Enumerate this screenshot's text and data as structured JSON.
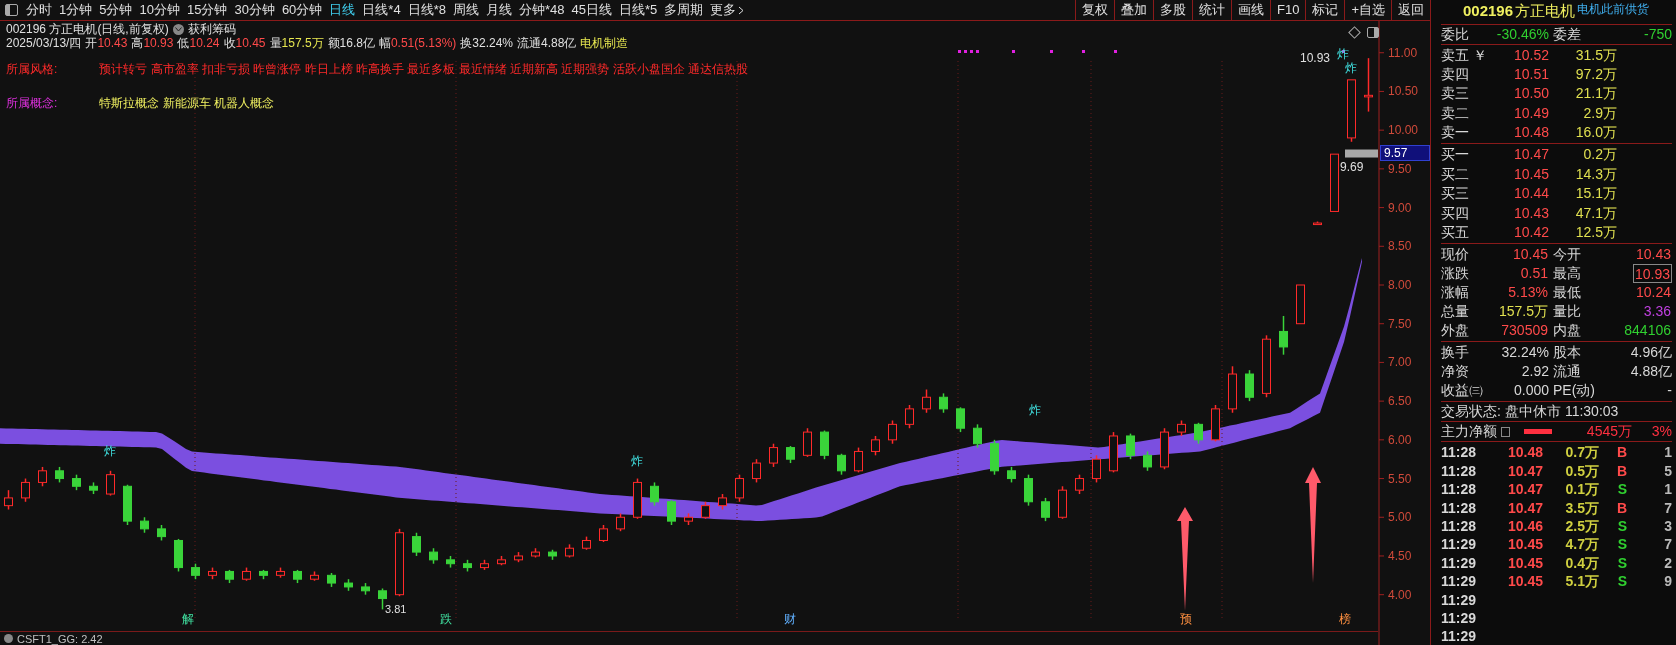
{
  "toolbar": {
    "periods": [
      {
        "label": "分时",
        "selected": false
      },
      {
        "label": "1分钟",
        "selected": false
      },
      {
        "label": "5分钟",
        "selected": false
      },
      {
        "label": "10分钟",
        "selected": false
      },
      {
        "label": "15分钟",
        "selected": false
      },
      {
        "label": "30分钟",
        "selected": false
      },
      {
        "label": "60分钟",
        "selected": false
      },
      {
        "label": "日线",
        "selected": true
      },
      {
        "label": "日线*4",
        "selected": false
      },
      {
        "label": "日线*8",
        "selected": false
      },
      {
        "label": "周线",
        "selected": false
      },
      {
        "label": "月线",
        "selected": false
      },
      {
        "label": "分钟*48",
        "selected": false
      },
      {
        "label": "45日线",
        "selected": false
      },
      {
        "label": "日线*5",
        "selected": false
      },
      {
        "label": "多周期",
        "selected": false
      },
      {
        "label": "更多",
        "selected": false
      }
    ],
    "actions": [
      "复权",
      "叠加",
      "多股",
      "统计",
      "画线",
      "F10",
      "标记",
      "+自选",
      "返回"
    ]
  },
  "header": {
    "title": "002196 方正电机(日线,前复权)",
    "indicator": "获利筹码",
    "date": "2025/03/13/四",
    "quote": [
      {
        "label": "开",
        "value": "10.43",
        "color": "#ff4a4a"
      },
      {
        "label": "高",
        "value": "10.93",
        "color": "#ff4a4a"
      },
      {
        "label": "低",
        "value": "10.24",
        "color": "#ff4a4a"
      },
      {
        "label": "收",
        "value": "10.45",
        "color": "#ff4a4a"
      },
      {
        "label": "量",
        "value": "157.5万",
        "color": "#e8e850"
      },
      {
        "label": "额",
        "value": "16.8亿",
        "color": "#e0e0e0"
      },
      {
        "label": "幅",
        "value": "0.51(5.13%)",
        "color": "#ff4a4a"
      },
      {
        "label": "换",
        "value": "32.24%",
        "color": "#e0e0e0"
      },
      {
        "label": "流通",
        "value": "4.88亿",
        "color": "#e0e0e0"
      }
    ],
    "industry": "电机制造"
  },
  "style_row": {
    "label": "所属风格:",
    "tags": "预计转亏 高市盈率 扣非亏损 昨曾涨停 昨日上榜 昨高换手 最近多板 最近情绪 近期新高 近期强势 活跃小盘国企 通达信热股"
  },
  "concept_row": {
    "label": "所属概念:",
    "tags": "特斯拉概念 新能源车 机器人概念"
  },
  "chart": {
    "chart_data": {
      "type": "candlestick",
      "ohlc": [
        [
          5.15,
          5.35,
          5.1,
          5.25
        ],
        [
          5.25,
          5.5,
          5.2,
          5.45
        ],
        [
          5.45,
          5.65,
          5.4,
          5.6
        ],
        [
          5.6,
          5.65,
          5.45,
          5.5
        ],
        [
          5.5,
          5.55,
          5.35,
          5.4
        ],
        [
          5.4,
          5.45,
          5.3,
          5.35
        ],
        [
          5.3,
          5.6,
          5.28,
          5.55
        ],
        [
          5.4,
          5.42,
          4.9,
          4.95
        ],
        [
          4.95,
          5.0,
          4.8,
          4.85
        ],
        [
          4.85,
          4.9,
          4.7,
          4.75
        ],
        [
          4.7,
          4.72,
          4.3,
          4.35
        ],
        [
          4.35,
          4.4,
          4.2,
          4.25
        ],
        [
          4.25,
          4.35,
          4.2,
          4.3
        ],
        [
          4.3,
          4.32,
          4.15,
          4.2
        ],
        [
          4.2,
          4.35,
          4.18,
          4.3
        ],
        [
          4.3,
          4.32,
          4.2,
          4.25
        ],
        [
          4.25,
          4.35,
          4.22,
          4.3
        ],
        [
          4.3,
          4.32,
          4.15,
          4.2
        ],
        [
          4.2,
          4.3,
          4.18,
          4.25
        ],
        [
          4.25,
          4.28,
          4.1,
          4.15
        ],
        [
          4.15,
          4.2,
          4.05,
          4.1
        ],
        [
          4.1,
          4.15,
          4.0,
          4.05
        ],
        [
          4.05,
          4.08,
          3.81,
          3.95
        ],
        [
          4.0,
          4.85,
          3.98,
          4.8
        ],
        [
          4.75,
          4.8,
          4.5,
          4.55
        ],
        [
          4.55,
          4.6,
          4.4,
          4.45
        ],
        [
          4.45,
          4.5,
          4.35,
          4.4
        ],
        [
          4.4,
          4.45,
          4.3,
          4.35
        ],
        [
          4.35,
          4.45,
          4.32,
          4.4
        ],
        [
          4.4,
          4.5,
          4.38,
          4.45
        ],
        [
          4.45,
          4.55,
          4.42,
          4.5
        ],
        [
          4.5,
          4.6,
          4.48,
          4.55
        ],
        [
          4.55,
          4.58,
          4.45,
          4.5
        ],
        [
          4.5,
          4.65,
          4.48,
          4.6
        ],
        [
          4.6,
          4.75,
          4.58,
          4.7
        ],
        [
          4.7,
          4.9,
          4.68,
          4.85
        ],
        [
          4.85,
          5.05,
          4.82,
          5.0
        ],
        [
          5.0,
          5.5,
          4.98,
          5.45
        ],
        [
          5.4,
          5.45,
          5.15,
          5.2
        ],
        [
          5.2,
          5.22,
          4.9,
          4.95
        ],
        [
          4.95,
          5.05,
          4.9,
          5.0
        ],
        [
          5.0,
          5.2,
          4.98,
          5.15
        ],
        [
          5.15,
          5.3,
          5.1,
          5.25
        ],
        [
          5.25,
          5.55,
          5.2,
          5.5
        ],
        [
          5.5,
          5.75,
          5.45,
          5.7
        ],
        [
          5.7,
          5.95,
          5.65,
          5.9
        ],
        [
          5.9,
          5.92,
          5.7,
          5.75
        ],
        [
          5.8,
          6.15,
          5.78,
          6.1
        ],
        [
          6.1,
          6.12,
          5.75,
          5.8
        ],
        [
          5.8,
          5.82,
          5.55,
          5.6
        ],
        [
          5.6,
          5.9,
          5.58,
          5.85
        ],
        [
          5.85,
          6.05,
          5.8,
          6.0
        ],
        [
          6.0,
          6.25,
          5.95,
          6.2
        ],
        [
          6.2,
          6.45,
          6.15,
          6.4
        ],
        [
          6.4,
          6.65,
          6.35,
          6.55
        ],
        [
          6.55,
          6.6,
          6.35,
          6.4
        ],
        [
          6.4,
          6.42,
          6.1,
          6.15
        ],
        [
          6.15,
          6.2,
          5.9,
          5.95
        ],
        [
          5.95,
          6.0,
          5.55,
          5.6
        ],
        [
          5.6,
          5.65,
          5.45,
          5.5
        ],
        [
          5.5,
          5.55,
          5.15,
          5.2
        ],
        [
          5.2,
          5.25,
          4.95,
          5.0
        ],
        [
          5.0,
          5.4,
          4.98,
          5.35
        ],
        [
          5.35,
          5.55,
          5.3,
          5.5
        ],
        [
          5.5,
          5.8,
          5.45,
          5.75
        ],
        [
          5.6,
          6.1,
          5.58,
          6.05
        ],
        [
          6.05,
          6.08,
          5.75,
          5.8
        ],
        [
          5.8,
          5.85,
          5.6,
          5.65
        ],
        [
          5.65,
          6.15,
          5.62,
          6.1
        ],
        [
          6.1,
          6.25,
          6.05,
          6.2
        ],
        [
          6.2,
          6.22,
          5.95,
          6.0
        ],
        [
          6.0,
          6.45,
          5.98,
          6.4
        ],
        [
          6.4,
          6.95,
          6.35,
          6.85
        ],
        [
          6.85,
          6.9,
          6.5,
          6.55
        ],
        [
          6.6,
          7.35,
          6.55,
          7.3
        ],
        [
          7.4,
          7.6,
          7.1,
          7.2
        ],
        [
          7.5,
          8.0,
          7.5,
          8.0
        ],
        [
          8.8,
          8.82,
          8.78,
          8.8
        ],
        [
          8.95,
          9.69,
          8.95,
          9.69
        ],
        [
          9.9,
          10.65,
          9.85,
          10.65
        ],
        [
          10.43,
          10.93,
          10.24,
          10.45
        ]
      ],
      "ylim": [
        3.66,
        11.41
      ],
      "grid": true,
      "yticks": [
        {
          "value": 11,
          "label": "11.00"
        },
        {
          "value": 10.5,
          "label": "10.50"
        },
        {
          "value": 10,
          "label": "10.00"
        },
        {
          "value": 9.5,
          "label": "9.50"
        },
        {
          "value": 9,
          "label": "9.00"
        },
        {
          "value": 8.5,
          "label": "8.50"
        },
        {
          "value": 8,
          "label": "8.00"
        },
        {
          "value": 7.5,
          "label": "7.50"
        },
        {
          "value": 7,
          "label": "7.00"
        },
        {
          "value": 6.5,
          "label": "6.50"
        },
        {
          "value": 6,
          "label": "6.00"
        },
        {
          "value": 5.5,
          "label": "5.50"
        },
        {
          "value": 5,
          "label": "5.00"
        },
        {
          "value": 4.5,
          "label": "4.50"
        },
        {
          "value": 4,
          "label": "4.00"
        }
      ]
    },
    "price_tag": "9.57",
    "high_label": "10.93",
    "prev_label": "9.69",
    "low_label": "3.81",
    "signal_marks": [
      "炸",
      "炸",
      "炸",
      "炸",
      "炸"
    ],
    "event_marks": [
      "解",
      "跌",
      "财",
      "预",
      "榜"
    ],
    "indicator_line": "CSFT1_GG: 2.42"
  },
  "quote_panel": {
    "code": "002196",
    "name": "方正电机",
    "note": "电机此前供货",
    "ratio": [
      {
        "label": "委比",
        "value": "-30.46%"
      },
      {
        "label": "委差",
        "value": "-750"
      }
    ],
    "asks": [
      {
        "label": "卖五",
        "mark": "￥",
        "price": "10.52",
        "volume": "31.5万"
      },
      {
        "label": "卖四",
        "price": "10.51",
        "volume": "97.2万"
      },
      {
        "label": "卖三",
        "price": "10.50",
        "volume": "21.1万"
      },
      {
        "label": "卖二",
        "price": "10.49",
        "volume": "2.9万"
      },
      {
        "label": "卖一",
        "price": "10.48",
        "volume": "16.0万"
      }
    ],
    "bids": [
      {
        "label": "买一",
        "price": "10.47",
        "volume": "0.2万"
      },
      {
        "label": "买二",
        "price": "10.45",
        "volume": "14.3万"
      },
      {
        "label": "买三",
        "price": "10.44",
        "volume": "15.1万"
      },
      {
        "label": "买四",
        "price": "10.43",
        "volume": "47.1万"
      },
      {
        "label": "买五",
        "price": "10.42",
        "volume": "12.5万"
      }
    ],
    "stats": [
      [
        {
          "label": "现价",
          "value": "10.45",
          "color": "#ff4a4a",
          "outlined": false
        },
        {
          "label": "今开",
          "value": "10.43",
          "color": "#ff4a4a",
          "outlined": false
        }
      ],
      [
        {
          "label": "涨跌",
          "value": "0.51",
          "color": "#ff4a4a",
          "outlined": false
        },
        {
          "label": "最高",
          "value": "10.93",
          "color": "#ff4a4a",
          "outlined": true
        }
      ],
      [
        {
          "label": "涨幅",
          "value": "5.13%",
          "color": "#ff4a4a",
          "outlined": false
        },
        {
          "label": "最低",
          "value": "10.24",
          "color": "#ff4a4a",
          "outlined": false
        }
      ],
      [
        {
          "label": "总量",
          "value": "157.5万",
          "color": "#e0e050",
          "outlined": false
        },
        {
          "label": "量比",
          "value": "3.36",
          "color": "#c040e0",
          "outlined": false
        }
      ],
      [
        {
          "label": "外盘",
          "value": "730509",
          "color": "#ff4a4a",
          "outlined": false
        },
        {
          "label": "内盘",
          "value": "844106",
          "color": "#30d030",
          "outlined": false
        }
      ]
    ],
    "fundamentals": [
      [
        {
          "label": "换手",
          "value": "32.24%"
        },
        {
          "label": "股本",
          "value": "4.96亿"
        }
      ],
      [
        {
          "label": "净资",
          "value": "2.92"
        },
        {
          "label": "流通",
          "value": "4.88亿"
        }
      ],
      [
        {
          "label": "收益㈢",
          "value": "0.000"
        },
        {
          "label": "PE(动)",
          "value": "-"
        }
      ]
    ],
    "status": {
      "label": "交易状态:",
      "value": "盘中休市",
      "time": "11:30:03"
    },
    "main_force": {
      "label": "主力净额",
      "value": "4545万",
      "percent": "3%"
    },
    "ticks": [
      {
        "time": "11:28",
        "price": "10.48",
        "volume": "0.7万",
        "side": "B",
        "kind": "buy",
        "count": "1"
      },
      {
        "time": "11:28",
        "price": "10.47",
        "volume": "0.5万",
        "side": "B",
        "kind": "buy",
        "count": "5"
      },
      {
        "time": "11:28",
        "price": "10.47",
        "volume": "0.1万",
        "side": "S",
        "kind": "sell",
        "count": "1"
      },
      {
        "time": "11:28",
        "price": "10.47",
        "volume": "3.5万",
        "side": "B",
        "kind": "buy",
        "count": "7"
      },
      {
        "time": "11:28",
        "price": "10.46",
        "volume": "2.5万",
        "side": "S",
        "kind": "sell",
        "count": "3"
      },
      {
        "time": "11:29",
        "price": "10.45",
        "volume": "4.7万",
        "side": "S",
        "kind": "sell",
        "count": "7"
      },
      {
        "time": "11:29",
        "price": "10.45",
        "volume": "0.4万",
        "side": "S",
        "kind": "sell",
        "count": "2"
      },
      {
        "time": "11:29",
        "price": "10.45",
        "volume": "5.1万",
        "side": "S",
        "kind": "sell",
        "count": "9"
      },
      {
        "time": "11:29"
      },
      {
        "time": "11:29"
      },
      {
        "time": "11:29"
      }
    ]
  }
}
